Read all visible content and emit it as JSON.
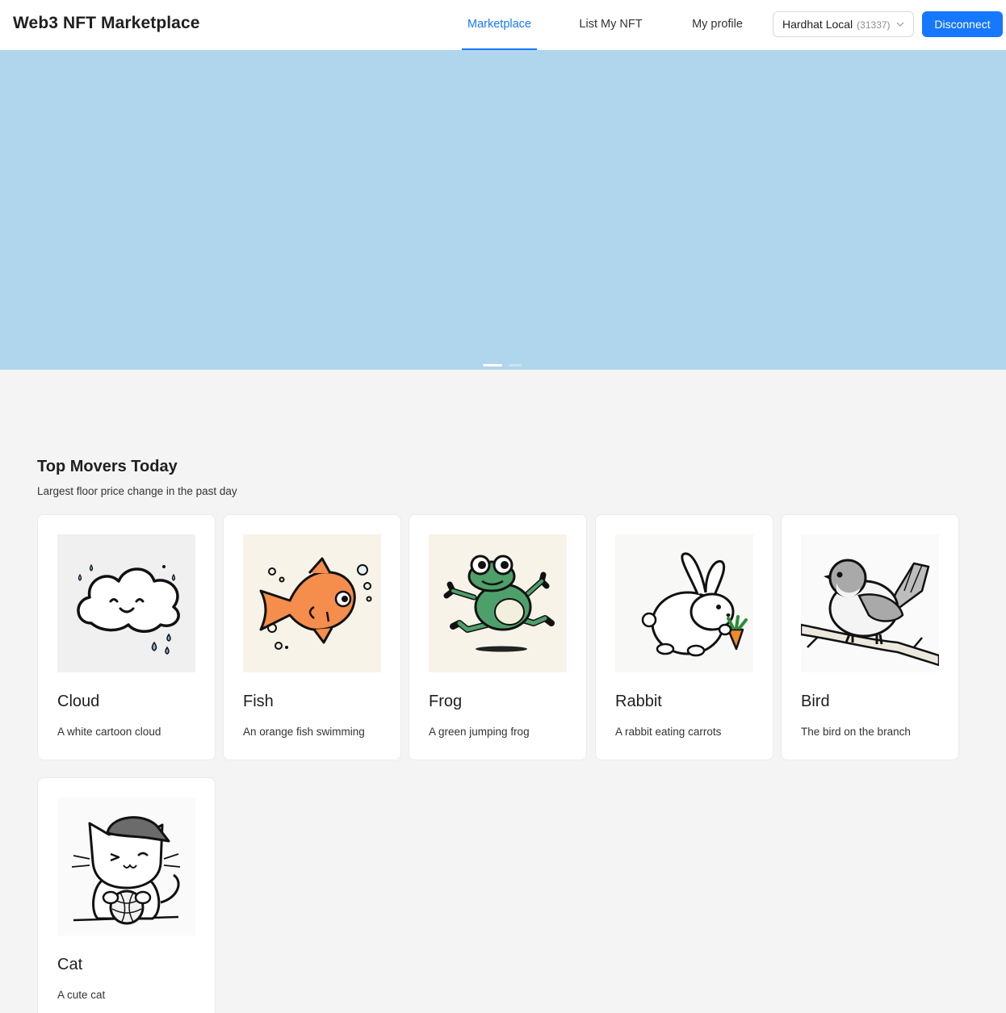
{
  "header": {
    "app_title": "Web3 NFT Marketplace",
    "tabs": [
      {
        "label": "Marketplace",
        "active": true
      },
      {
        "label": "List My NFT",
        "active": false
      },
      {
        "label": "My profile",
        "active": false
      }
    ],
    "network": {
      "name": "Hardhat Local",
      "chain_id": "(31337)"
    },
    "disconnect_label": "Disconnect"
  },
  "carousel": {
    "slides": 2,
    "active_slide": 1,
    "color": "#afd6ed"
  },
  "section": {
    "title": "Top Movers Today",
    "subtitle": "Largest floor price change in the past day"
  },
  "nfts": [
    {
      "name": "Cloud",
      "description": "A white cartoon cloud",
      "icon": "cloud-icon"
    },
    {
      "name": "Fish",
      "description": "An orange fish swimming",
      "icon": "fish-icon"
    },
    {
      "name": "Frog",
      "description": "A green jumping frog",
      "icon": "frog-icon"
    },
    {
      "name": "Rabbit",
      "description": "A rabbit eating carrots",
      "icon": "rabbit-icon"
    },
    {
      "name": "Bird",
      "description": "The bird on the branch",
      "icon": "bird-icon"
    },
    {
      "name": "Cat",
      "description": "A cute cat",
      "icon": "cat-icon"
    }
  ],
  "colors": {
    "accent": "#1677ff",
    "page_bg": "#f4f4f4"
  }
}
